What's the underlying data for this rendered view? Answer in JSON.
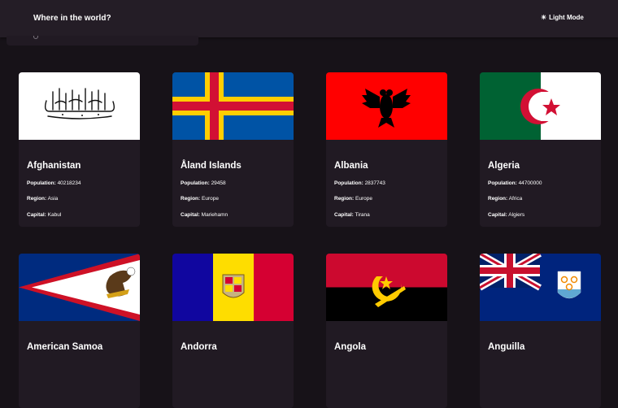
{
  "header": {
    "title": "Where in the world?",
    "mode_label": "Light Mode",
    "mode_icon": "sun-icon"
  },
  "search": {
    "icon": "search-icon"
  },
  "labels": {
    "population": "Population:",
    "region": "Region:",
    "capital": "Capital:"
  },
  "countries": [
    {
      "name": "Afghanistan",
      "population": "40218234",
      "region": "Asia",
      "capital": "Kabul"
    },
    {
      "name": "Åland Islands",
      "population": "29458",
      "region": "Europe",
      "capital": "Mariehamn"
    },
    {
      "name": "Albania",
      "population": "2837743",
      "region": "Europe",
      "capital": "Tirana"
    },
    {
      "name": "Algeria",
      "population": "44700000",
      "region": "Africa",
      "capital": "Algiers"
    },
    {
      "name": "American Samoa"
    },
    {
      "name": "Andorra"
    },
    {
      "name": "Angola"
    },
    {
      "name": "Anguilla"
    }
  ]
}
